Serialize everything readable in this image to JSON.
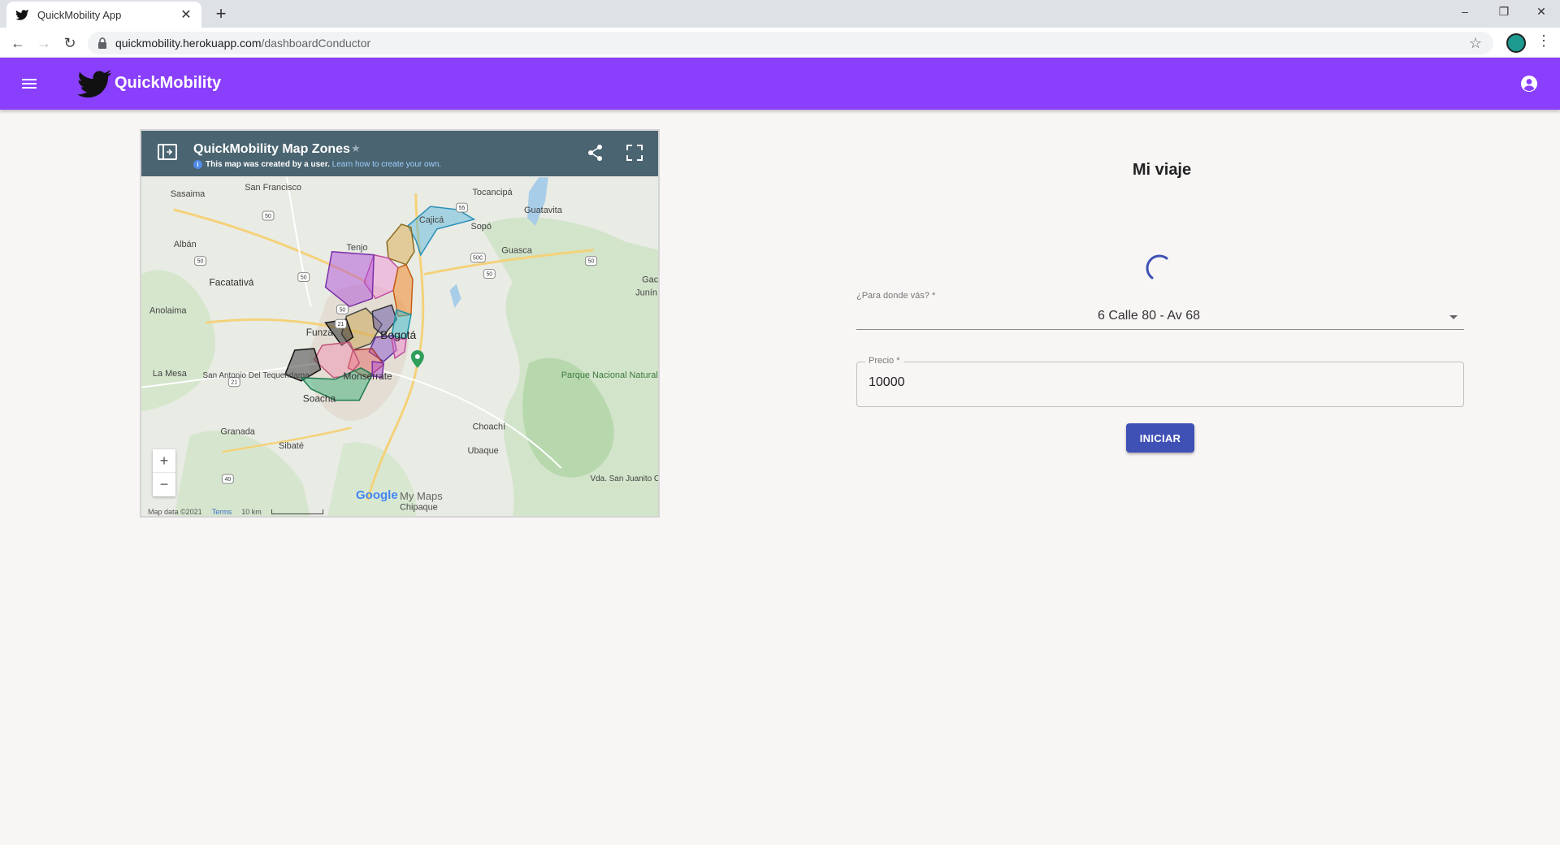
{
  "browser": {
    "tab_title": "QuickMobility App",
    "new_tab": "+",
    "url_host": "quickmobility.herokuapp.com",
    "url_path": "/dashboardConductor",
    "window_controls": {
      "minimize": "–",
      "restore": "❐",
      "close": "✕"
    }
  },
  "appbar": {
    "brand": "QuickMobility",
    "color": "#8a3ffc"
  },
  "map": {
    "title": "QuickMobility Map Zones",
    "notice": "This map was created by a user.",
    "notice_link": "Learn how to create your own.",
    "zoom_in": "+",
    "zoom_out": "−",
    "google": "Google",
    "mymaps": "My Maps",
    "footer": {
      "data": "Map data ©2021",
      "terms": "Terms",
      "scale": "10 km"
    },
    "places": [
      "Sasaima",
      "San Francisco",
      "Tocancipá",
      "Guatavita",
      "Cajicá",
      "Sopó",
      "Albán",
      "Tenjo",
      "Guasca",
      "Facatativá",
      "Gac",
      "Junín",
      "Anolaima",
      "Funza",
      "Bogotá",
      "La Mesa",
      "San Antonio Del Tequendama",
      "Monserrate",
      "Soacha",
      "Parque Nacional Natural Chingaza",
      "Granada",
      "Sibaté",
      "Chipaque",
      "Choachí",
      "Ubaque",
      "Vda. San Juanito Centro"
    ]
  },
  "trip": {
    "title": "Mi viaje",
    "destination_label": "¿Para donde vás? *",
    "destination_value": "6 Calle 80 - Av 68",
    "price_label": "Precio *",
    "price_value": "10000",
    "start_button": "INICIAR",
    "button_color": "#3f51b5"
  }
}
